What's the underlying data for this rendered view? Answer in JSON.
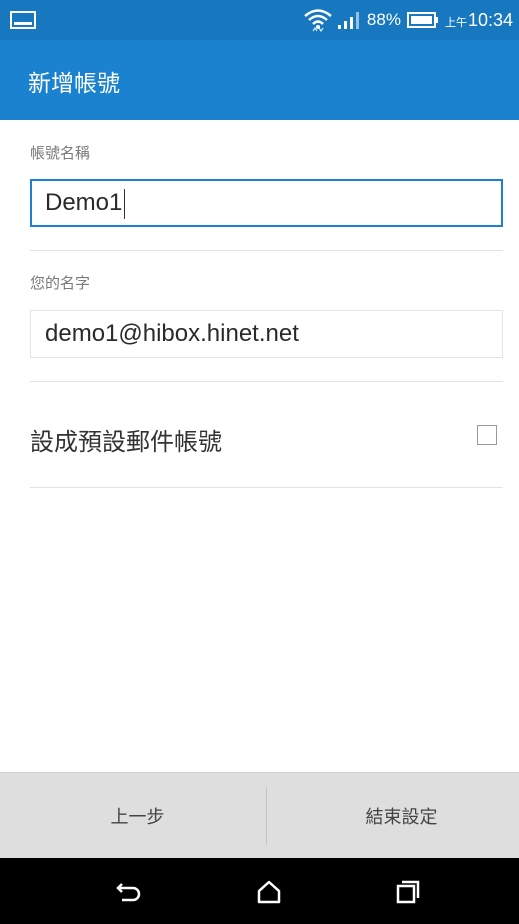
{
  "status_bar": {
    "battery_percent": "88%",
    "ampm": "上午",
    "time": "10:34",
    "icons": [
      "notification-icon",
      "wifi-icon",
      "signal-icon",
      "battery-icon"
    ]
  },
  "app_bar": {
    "title": "新增帳號"
  },
  "form": {
    "account_name_label": "帳號名稱",
    "account_name_value": "Demo1",
    "your_name_label": "您的名字",
    "your_name_value": "demo1@hibox.hinet.net",
    "default_account_label": "設成預設郵件帳號",
    "default_account_checked": false
  },
  "bottom_buttons": {
    "previous": "上一步",
    "finish": "結束設定"
  },
  "nav_bar": {
    "icons": [
      "back-icon",
      "home-icon",
      "recents-icon"
    ]
  },
  "colors": {
    "status_bar": "#1777bf",
    "app_bar": "#1b82cf",
    "focus_border": "#1b82cf"
  }
}
